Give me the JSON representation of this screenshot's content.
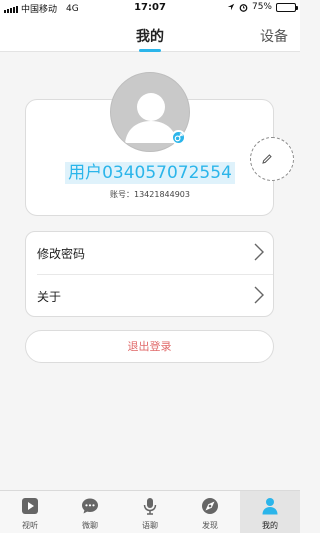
{
  "status_bar": {
    "carrier": "中国移动",
    "network": "4G",
    "time": "17:07",
    "battery": "75%",
    "battery_level": 0.75
  },
  "header": {
    "title": "我的",
    "right_action": "设备"
  },
  "profile": {
    "username": "用户034057072554",
    "account_label": "账号：",
    "account_number": "13421844903",
    "gender": "male"
  },
  "menu": {
    "items": [
      {
        "label": "修改密码"
      },
      {
        "label": "关于"
      }
    ]
  },
  "logout_label": "退出登录",
  "tabs": [
    {
      "label": "视听",
      "icon": "play-icon",
      "active": false
    },
    {
      "label": "微聊",
      "icon": "chat-icon",
      "active": false
    },
    {
      "label": "语聊",
      "icon": "microphone-icon",
      "active": false
    },
    {
      "label": "发现",
      "icon": "discover-icon",
      "active": false
    },
    {
      "label": "我的",
      "icon": "person-icon",
      "active": true
    }
  ],
  "colors": {
    "accent": "#2bb5ea",
    "logout_text": "#e06a6a",
    "tab_icon": "#666666"
  }
}
